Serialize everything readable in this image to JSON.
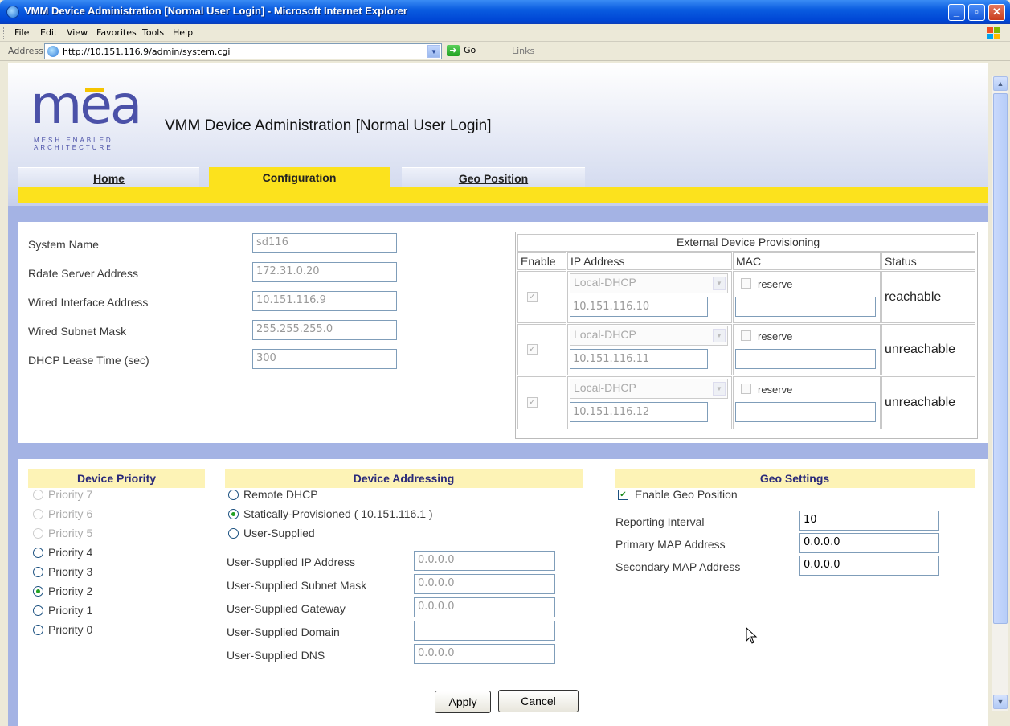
{
  "window": {
    "title": "VMM Device Administration [Normal User Login] - Microsoft Internet Explorer",
    "controls": [
      "minimize",
      "maximize",
      "close"
    ]
  },
  "menu": [
    "File",
    "Edit",
    "View",
    "Favorites",
    "Tools",
    "Help"
  ],
  "addressbar": {
    "label": "Address",
    "url": "http://10.151.116.9/admin/system.cgi",
    "go_label": "Go",
    "links_label": "Links"
  },
  "header": {
    "logo_text": "mea",
    "logo_sub1": "MESH ENABLED",
    "logo_sub2": "ARCHITECTURE",
    "title": "VMM Device Administration [Normal User Login]",
    "tabs": [
      {
        "label": "Home",
        "active": false
      },
      {
        "label": "Configuration",
        "active": true
      },
      {
        "label": "Geo Position",
        "active": false
      }
    ]
  },
  "system": {
    "fields": [
      {
        "label": "System Name",
        "value": "sd116"
      },
      {
        "label": "Rdate Server Address",
        "value": "172.31.0.20"
      },
      {
        "label": "Wired Interface Address",
        "value": "10.151.116.9"
      },
      {
        "label": "Wired Subnet Mask",
        "value": "255.255.255.0"
      },
      {
        "label": "DHCP Lease Time (sec)",
        "value": "300"
      }
    ]
  },
  "edp": {
    "title": "External Device Provisioning",
    "columns": [
      "Enable",
      "IP Address",
      "MAC",
      "Status"
    ],
    "rows": [
      {
        "enabled": true,
        "mode": "Local-DHCP",
        "ip": "10.151.116.10",
        "reserve_label": "reserve",
        "mac": "",
        "status": "reachable"
      },
      {
        "enabled": true,
        "mode": "Local-DHCP",
        "ip": "10.151.116.11",
        "reserve_label": "reserve",
        "mac": "",
        "status": "unreachable"
      },
      {
        "enabled": true,
        "mode": "Local-DHCP",
        "ip": "10.151.116.12",
        "reserve_label": "reserve",
        "mac": "",
        "status": "unreachable"
      }
    ]
  },
  "priority": {
    "title": "Device Priority",
    "options": [
      {
        "label": "Priority 7",
        "disabled": true,
        "selected": false
      },
      {
        "label": "Priority 6",
        "disabled": true,
        "selected": false
      },
      {
        "label": "Priority 5",
        "disabled": true,
        "selected": false
      },
      {
        "label": "Priority 4",
        "disabled": false,
        "selected": false
      },
      {
        "label": "Priority 3",
        "disabled": false,
        "selected": false
      },
      {
        "label": "Priority 2",
        "disabled": false,
        "selected": true
      },
      {
        "label": "Priority 1",
        "disabled": false,
        "selected": false
      },
      {
        "label": "Priority 0",
        "disabled": false,
        "selected": false
      }
    ]
  },
  "addressing": {
    "title": "Device Addressing",
    "options": [
      {
        "label": "Remote DHCP",
        "selected": false
      },
      {
        "label": "Statically-Provisioned ( 10.151.116.1 )",
        "selected": true
      },
      {
        "label": "User-Supplied",
        "selected": false
      }
    ],
    "fields": [
      {
        "label": "User-Supplied IP Address",
        "value": "0.0.0.0"
      },
      {
        "label": "User-Supplied Subnet Mask",
        "value": "0.0.0.0"
      },
      {
        "label": "User-Supplied Gateway",
        "value": "0.0.0.0"
      },
      {
        "label": "User-Supplied Domain",
        "value": ""
      },
      {
        "label": "User-Supplied DNS",
        "value": "0.0.0.0"
      }
    ]
  },
  "geo": {
    "title": "Geo Settings",
    "enable_label": "Enable Geo Position",
    "enabled": true,
    "fields": [
      {
        "label": "Reporting Interval",
        "value": "10"
      },
      {
        "label": "Primary MAP Address",
        "value": "0.0.0.0"
      },
      {
        "label": "Secondary MAP Address",
        "value": "0.0.0.0"
      }
    ]
  },
  "actions": {
    "apply": "Apply",
    "cancel": "Cancel"
  },
  "colors": {
    "accent_yellow": "#fce21d",
    "page_bg": "#a4b3e4",
    "logo_blue": "#4b51a8",
    "title_blue": "#0046d5"
  }
}
